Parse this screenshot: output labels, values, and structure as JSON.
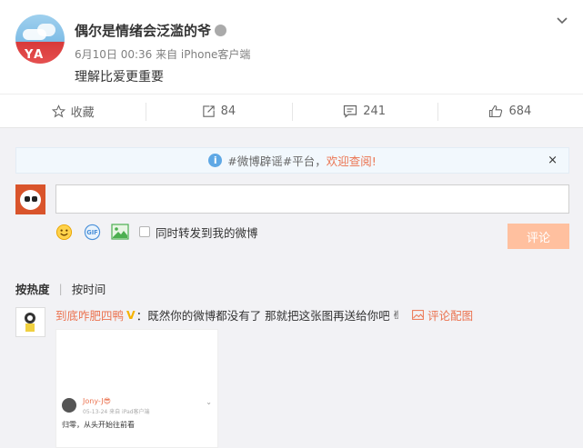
{
  "post": {
    "username": "偶尔是情绪会泛滥的爷",
    "avatar_text": "YA",
    "meta": "6月10日 00:36 来自 iPhone客户端",
    "content": "理解比爱更重要"
  },
  "actions": {
    "favorite": "收藏",
    "repost": "84",
    "comment": "241",
    "like": "684"
  },
  "notice": {
    "text": "#微博辟谣#平台，",
    "link": "欢迎查阅!",
    "close": "×"
  },
  "composer": {
    "placeholder": "",
    "checkbox_label": "同时转发到我的微博",
    "submit": "评论"
  },
  "sort": {
    "active": "按热度",
    "separator": "|",
    "other": "按时间"
  },
  "comment": {
    "user": "到底咋肥四鸭",
    "text": "：既然你的微博都没有了 那就把这张图再送给你吧",
    "pic_link": "评论配图",
    "image": {
      "name": "Jony-J😎",
      "meta": "05-13-24 来自 iPad客户端",
      "text": "归零，从头开始往前看"
    }
  },
  "colors": {
    "accent": "#eb7350",
    "submit_disabled": "#ffc09f",
    "notice_bg": "#f2f8fd"
  }
}
